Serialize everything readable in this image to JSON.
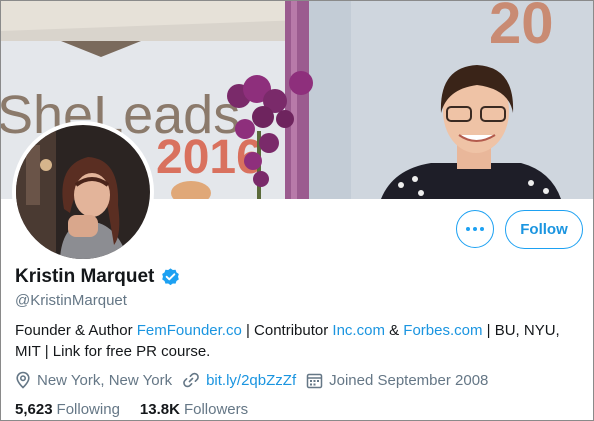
{
  "banner": {
    "sign_text_1": "SheLeads",
    "sign_text_2": "2016",
    "corner_text": "20"
  },
  "actions": {
    "more_icon": "more-horizontal-icon",
    "follow_label": "Follow"
  },
  "profile": {
    "name": "Kristin Marquet",
    "verified_icon": "verified-badge-icon",
    "handle": "@KristinMarquet",
    "bio": {
      "part1": "Founder & Author ",
      "link1": "FemFounder.co",
      "part2": " | Contributor ",
      "link2": "Inc.com",
      "part3": " & ",
      "link3": "Forbes.com",
      "part4": " | BU, NYU, MIT | Link for free PR course."
    },
    "location": "New York, New York",
    "website": "bit.ly/2qbZzZf",
    "joined": "Joined September 2008"
  },
  "stats": {
    "following_count": "5,623",
    "following_label": "Following",
    "followers_count": "13.8K",
    "followers_label": "Followers"
  },
  "colors": {
    "accent": "#1da1f2",
    "link": "#1b95e0",
    "secondary_text": "#657786",
    "primary_text": "#14171a"
  }
}
